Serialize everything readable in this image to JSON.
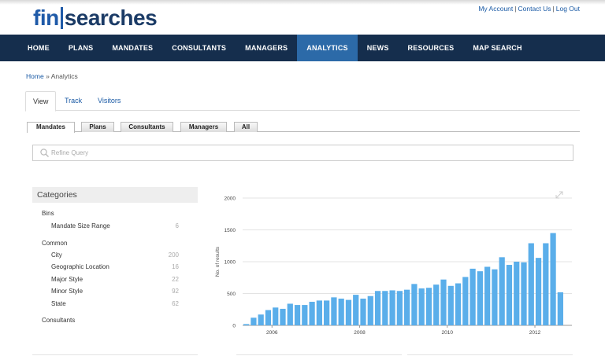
{
  "logo": {
    "part1": "fin",
    "part2": "searches"
  },
  "top_links": {
    "account": "My Account",
    "contact": "Contact Us",
    "logout": "Log Out",
    "separator": "|"
  },
  "nav": {
    "items": [
      "HOME",
      "PLANS",
      "MANDATES",
      "CONSULTANTS",
      "MANAGERS",
      "ANALYTICS",
      "NEWS",
      "RESOURCES",
      "MAP SEARCH"
    ],
    "active": "ANALYTICS"
  },
  "breadcrumb": {
    "home": "Home",
    "separator": "»",
    "current": "Analytics"
  },
  "subtabs": {
    "items": [
      "View",
      "Track",
      "Visitors"
    ],
    "active": "View"
  },
  "filter_tabs": {
    "items": [
      "Mandates",
      "Plans",
      "Consultants",
      "Managers",
      "All"
    ],
    "active": "Mandates"
  },
  "search": {
    "placeholder": "Refine Query",
    "value": ""
  },
  "categories": {
    "title": "Categories",
    "groups": [
      {
        "name": "Bins",
        "items": [
          {
            "label": "Mandate Size Range",
            "count": "6"
          }
        ]
      },
      {
        "name": "Common",
        "items": [
          {
            "label": "City",
            "count": "200"
          },
          {
            "label": "Geographic Location",
            "count": "16"
          },
          {
            "label": "Major Style",
            "count": "22"
          },
          {
            "label": "Minor Style",
            "count": "92"
          },
          {
            "label": "State",
            "count": "62"
          }
        ]
      },
      {
        "name": "Consultants",
        "items": []
      }
    ]
  },
  "colors": {
    "nav_bg": "#152e4d",
    "nav_active": "#2c6aa8",
    "link": "#1a5aa5",
    "bar": "#5aaeea"
  },
  "chart_data": {
    "type": "bar",
    "ylabel": "No. of results",
    "xlabel": "",
    "title": "",
    "ylim": [
      0,
      2000
    ],
    "yticks": [
      0,
      500,
      1000,
      1500,
      2000
    ],
    "xticks": [
      "2006",
      "2008",
      "2010",
      "2012",
      "2014",
      "2016"
    ],
    "grid": true,
    "x_start_year": 2005.33,
    "period_years": 0.1667,
    "values": [
      20,
      120,
      170,
      240,
      280,
      260,
      340,
      320,
      320,
      370,
      390,
      390,
      440,
      420,
      400,
      480,
      420,
      460,
      540,
      540,
      550,
      540,
      560,
      650,
      580,
      590,
      640,
      720,
      620,
      660,
      760,
      890,
      850,
      920,
      880,
      1070,
      950,
      1000,
      990,
      1290,
      1060,
      1290,
      1450,
      520
    ]
  }
}
